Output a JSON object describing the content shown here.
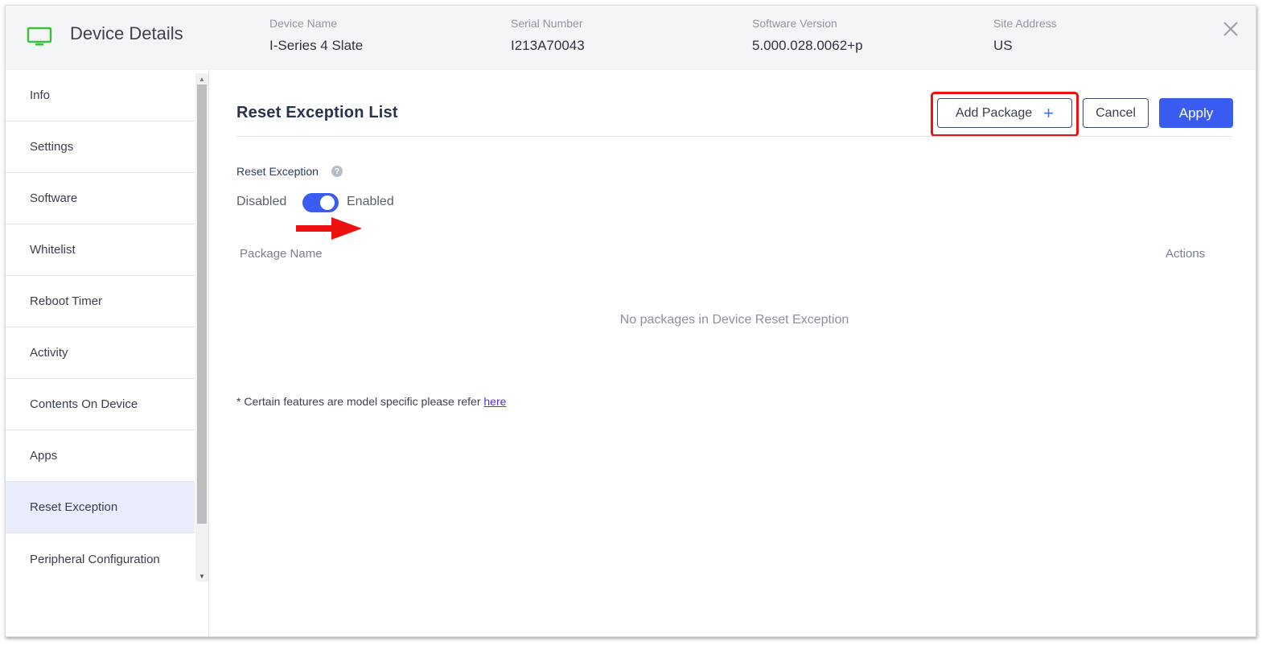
{
  "header": {
    "title": "Device Details",
    "monitor_icon": "monitor-icon",
    "monitor_icon_color": "#3cc03c",
    "device_name": {
      "label": "Device Name",
      "value": "I-Series 4 Slate"
    },
    "serial_number": {
      "label": "Serial Number",
      "value": "I213A70043"
    },
    "software_version": {
      "label": "Software Version",
      "value": "5.000.028.0062+p"
    },
    "site_address": {
      "label": "Site Address",
      "value": "US"
    },
    "close_icon": "close-icon"
  },
  "sidebar": {
    "items": [
      {
        "label": "Info"
      },
      {
        "label": "Settings"
      },
      {
        "label": "Software"
      },
      {
        "label": "Whitelist"
      },
      {
        "label": "Reboot Timer"
      },
      {
        "label": "Activity"
      },
      {
        "label": "Contents On Device"
      },
      {
        "label": "Apps"
      },
      {
        "label": "Reset Exception",
        "active": true
      },
      {
        "label": "Peripheral Configuration"
      }
    ]
  },
  "main": {
    "title": "Reset Exception List",
    "add_package_label": "Add Package",
    "add_package_plus": "+",
    "cancel_label": "Cancel",
    "apply_label": "Apply",
    "reset_exception_label": "Reset Exception",
    "help_icon": "?",
    "toggle": {
      "off_label": "Disabled",
      "on_label": "Enabled",
      "state": "enabled"
    },
    "table": {
      "columns": [
        "Package Name",
        "Actions"
      ],
      "empty_message": "No packages in Device Reset Exception"
    },
    "footnote": {
      "text": "* Certain features are model specific please refer ",
      "link": "here"
    }
  },
  "colors": {
    "accent": "#3b5cf0",
    "highlight": "#ee1111",
    "active_nav_bg": "#e8ecfc"
  }
}
